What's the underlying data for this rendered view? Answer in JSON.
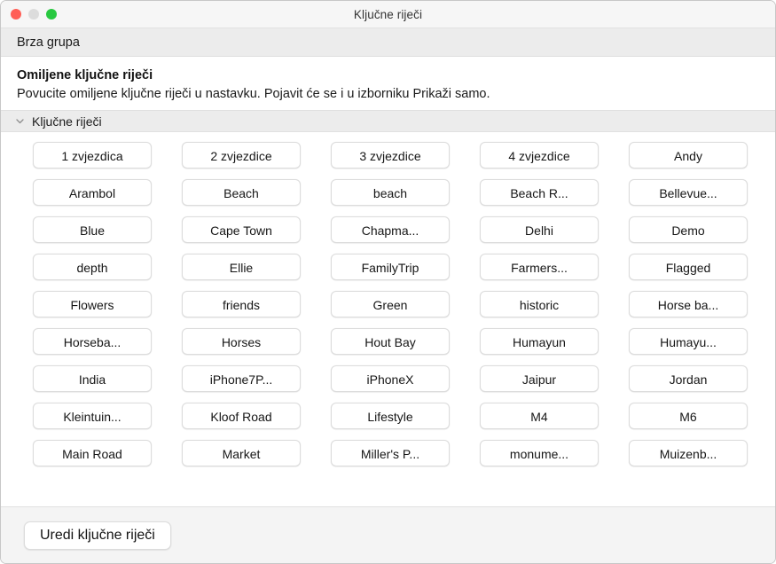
{
  "window": {
    "title": "Ključne riječi",
    "traffic_lights": [
      {
        "name": "close",
        "color": "#ff5f57"
      },
      {
        "name": "minimize",
        "color": "#dcdcdc"
      },
      {
        "name": "zoom",
        "color": "#28c840"
      }
    ]
  },
  "toolbar": {
    "label": "Brza grupa"
  },
  "intro": {
    "title": "Omiljene ključne riječi",
    "description": "Povucite omiljene ključne riječi u nastavku. Pojavit će se i u izborniku Prikaži samo."
  },
  "section": {
    "title": "Ključne riječi",
    "disclosure_icon": "chevron-down-icon",
    "expanded": true
  },
  "keywords": [
    "1 zvjezdica",
    "2 zvjezdice",
    "3 zvjezdice",
    "4 zvjezdice",
    "Andy",
    "Arambol",
    "Beach",
    "beach",
    "Beach R...",
    "Bellevue...",
    "Blue",
    "Cape Town",
    "Chapma...",
    "Delhi",
    "Demo",
    "depth",
    "Ellie",
    "FamilyTrip",
    "Farmers...",
    "Flagged",
    "Flowers",
    "friends",
    "Green",
    "historic",
    "Horse ba...",
    "Horseba...",
    "Horses",
    "Hout Bay",
    "Humayun",
    "Humayu...",
    "India",
    "iPhone7P...",
    "iPhoneX",
    "Jaipur",
    "Jordan",
    "Kleintuin...",
    "Kloof Road",
    "Lifestyle",
    "M4",
    "M6",
    "Main Road",
    "Market",
    "Miller's P...",
    "monume...",
    "Muizenb..."
  ],
  "footer": {
    "edit_label": "Uredi ključne riječi"
  },
  "colors": {
    "titlebar_bg": "#f6f6f6",
    "toolbar_bg": "#ececec",
    "content_bg": "#ffffff",
    "section_bg": "#ececec",
    "footer_bg": "#f4f4f4",
    "button_bg": "#ffffff",
    "button_border": "#dcdcdc",
    "text": "#1b1b1b"
  }
}
